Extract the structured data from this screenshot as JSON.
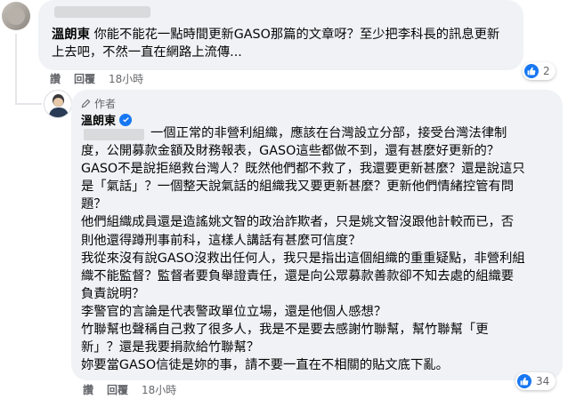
{
  "comment": {
    "name": "溫朗東",
    "text": "你能不能花一點時間更新GASO那篇的文章呀？至少把李科長的訊息更新上去吧，不然一直在網路上流傳...",
    "actions": {
      "like": "讚",
      "reply": "回覆",
      "time": "18小時"
    },
    "reaction_count": "2"
  },
  "reply": {
    "author_badge": "作者",
    "name": "溫朗東",
    "lines": [
      "一個正常的非營利組織，應該在台灣設立分部，接受台灣法律制",
      "度，公開募款金額及財務報表，GASO這些都做不到，還有甚麼好更新的？",
      "GASO不是說拒絕救台灣人？既然他們都不救了，我還要更新甚麼？還是說這只",
      "是「氣話」？一個整天說氣話的組織我又要更新甚麼？更新他們情緒控管有問",
      "題？",
      "他們組織成員還是造謠姚文智的政治詐欺者，只是姚文智沒跟他計較而已，否",
      "則他還得蹲刑事前科，這樣人講話有甚麼可信度？",
      "我從來沒有說GASO沒救出任何人，我只是指出這個組織的重重疑點，非營利組",
      "織不能監督？監督者要負舉證責任，還是向公眾募款善款卻不知去處的組織要",
      "負責說明？",
      "李警官的言論是代表警政單位立場，還是他個人感想？",
      "竹聯幫也聲稱自己救了很多人，我是不是要去感謝竹聯幫，幫竹聯幫「更",
      "新」？還是我要捐款給竹聯幫？",
      "妳要當GASO信徒是妳的事，請不要一直在不相關的貼文底下亂。"
    ],
    "actions": {
      "like": "讚",
      "reply": "回覆",
      "time": "18小時"
    },
    "reaction_count": "34"
  },
  "colors": {
    "bubble": "#f0f2f5",
    "like_blue": "#1877f2",
    "meta_gray": "#65676b"
  },
  "icons": [
    "like-icon",
    "verified-icon",
    "author-pen-icon"
  ]
}
